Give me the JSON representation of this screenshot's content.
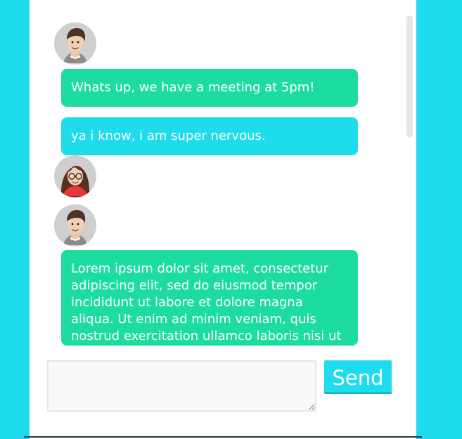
{
  "chat": {
    "messages": [
      {
        "avatar": "male-avatar-icon",
        "text": "Whats up, we have a meeting at 5pm!"
      },
      {
        "avatar": "female-avatar-icon",
        "text": "ya i know, i am super nervous."
      },
      {
        "avatar": "male-avatar-icon",
        "text": "Lorem ipsum dolor sit amet, consectetur adipiscing elit, sed do eiusmod tempor incididunt ut labore et dolore magna aliqua. Ut enim ad minim veniam, quis nostrud exercitation ullamco laboris nisi ut aliquip ex"
      }
    ]
  },
  "composer": {
    "placeholder": "",
    "value": ""
  },
  "controls": {
    "send_label": "Send"
  },
  "colors": {
    "outer_background": "#1fdcec",
    "panel_background": "#ffffff",
    "green_bubble": "#1ddc9f",
    "cyan_bubble": "#1fdcec",
    "send_button": "#1fdcec"
  }
}
